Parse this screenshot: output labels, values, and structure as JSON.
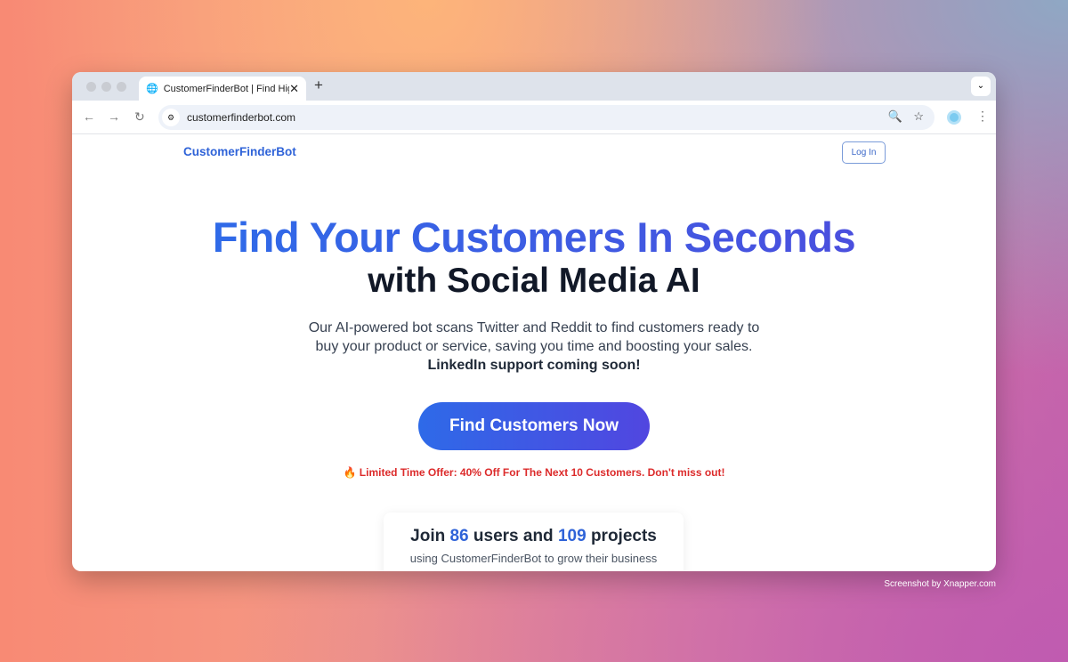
{
  "browser": {
    "tab_title": "CustomerFinderBot | Find High",
    "url": "customerfinderbot.com",
    "icons": [
      "globe-icon",
      "close-icon",
      "plus-icon",
      "chevron-down-icon",
      "back-icon",
      "forward-icon",
      "reload-icon",
      "site-settings-icon",
      "zoom-out-icon",
      "star-icon",
      "extension-icon",
      "more-icon"
    ]
  },
  "site": {
    "brand": "CustomerFinderBot",
    "login_label": "Log In",
    "headline_1": "Find Your Customers In Seconds",
    "headline_2": "with Social Media AI",
    "description": "Our AI-powered bot scans Twitter and Reddit to find customers ready to buy your product or service, saving you time and boosting your sales.",
    "description_bold": "LinkedIn support coming soon!",
    "cta_label": "Find Customers Now",
    "offer_icon": "🔥",
    "offer": "Limited Time Offer: 40% Off For The Next 10 Customers. Don't miss out!",
    "stats": {
      "join": "Join",
      "users": "86",
      "users_label": "users and",
      "projects": "109",
      "projects_label": "projects",
      "subtitle": "using CustomerFinderBot to grow their business"
    }
  },
  "colors": {
    "brand": "#2f63d8",
    "cta_start": "#2e6ae8",
    "cta_end": "#5146e0",
    "offer": "#dc2b2b"
  },
  "credit": "Screenshot by Xnapper.com"
}
